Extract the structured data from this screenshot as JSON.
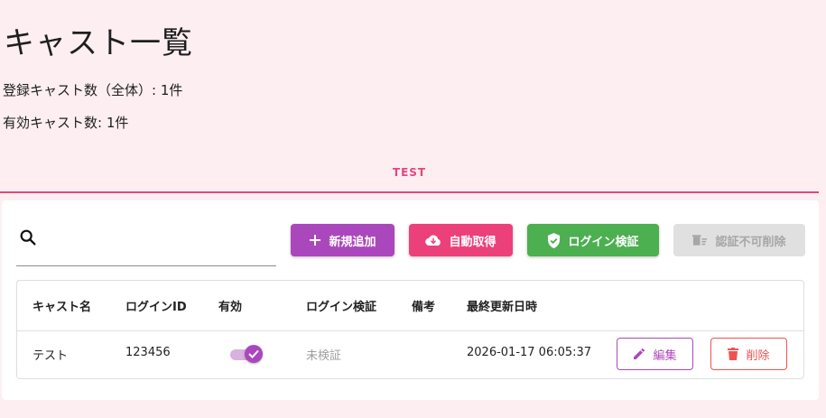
{
  "page": {
    "title": "キャスト一覧",
    "registered_count": "登録キャスト数（全体）: 1件",
    "active_count": "有効キャスト数: 1件"
  },
  "tabs": [
    {
      "label": "TEST",
      "active": true
    }
  ],
  "toolbar": {
    "search_placeholder": "",
    "new_label": "新規追加",
    "auto_label": "自動取得",
    "login_verify_label": "ログイン検証",
    "delete_unverified_label": "認証不可削除"
  },
  "table": {
    "headers": [
      "キャスト名",
      "ログインID",
      "有効",
      "ログイン検証",
      "備考",
      "最終更新日時"
    ],
    "rows": [
      {
        "name": "テスト",
        "login_id": "123456",
        "enabled": true,
        "login_verification": "未検証",
        "note": "",
        "updated_at": "2026-01-17 06:05:37",
        "edit_label": "編集",
        "delete_label": "削除"
      }
    ]
  },
  "colors": {
    "background": "#fdeef2",
    "accent_pink": "#e5457f",
    "purple": "#ab47bc",
    "pink": "#ec407a",
    "green": "#4caf50",
    "red": "#ef5350",
    "disabled": "#e0e0e0"
  },
  "icons": {
    "search": "search-icon",
    "new": "plus-icon",
    "auto": "cloud-download-icon",
    "login": "shield-check-icon",
    "delete_unverified": "delete-sweep-icon",
    "edit": "pencil-icon",
    "delete": "trash-icon",
    "toggle_check": "check-icon"
  }
}
